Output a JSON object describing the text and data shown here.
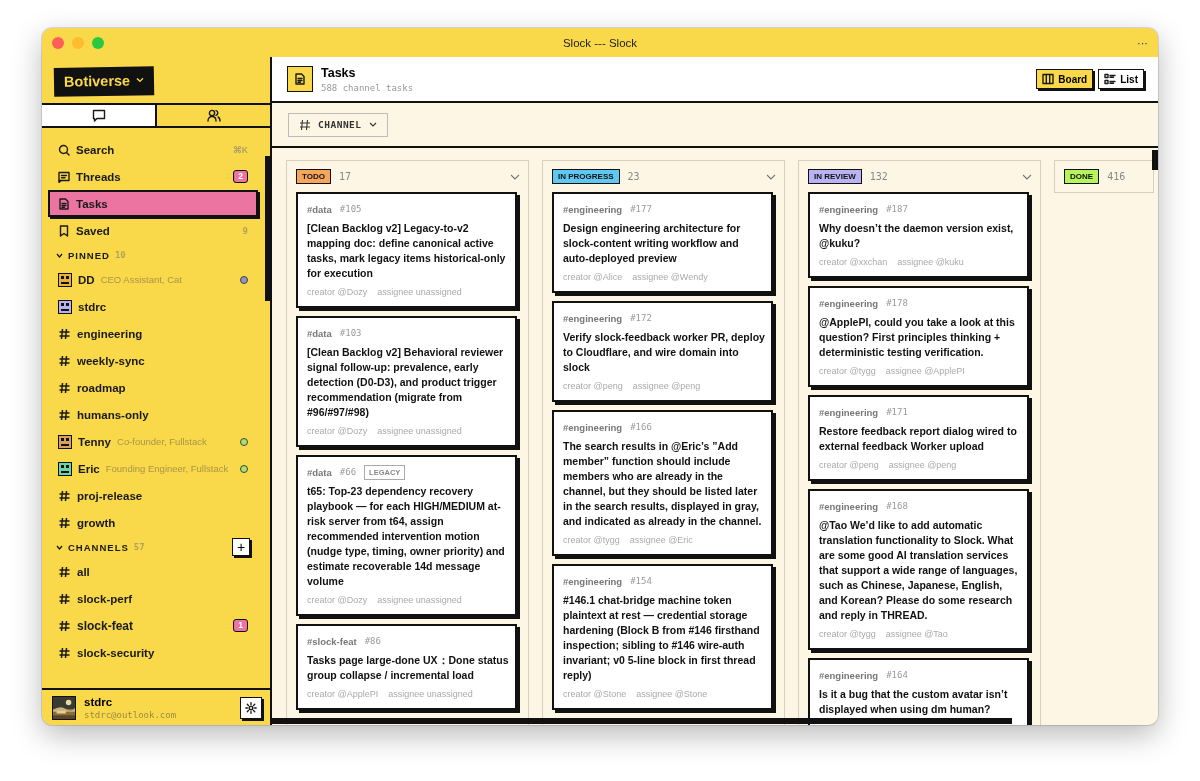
{
  "window": {
    "title": "Slock --- Slock",
    "menu": "···"
  },
  "sidebar": {
    "workspace": "Botiverse",
    "tabs": [
      {
        "kind": "chat",
        "selected": true
      },
      {
        "kind": "people",
        "selected": false
      }
    ],
    "nav": [
      {
        "kind": "search",
        "label": "Search",
        "shortcut": "⌘K",
        "selected": false
      },
      {
        "kind": "threads",
        "label": "Threads",
        "badge": "2",
        "selected": false
      },
      {
        "kind": "tasks",
        "label": "Tasks",
        "selected": true
      },
      {
        "kind": "saved",
        "label": "Saved",
        "count": "9",
        "selected": false
      }
    ],
    "sections": [
      {
        "title": "PINNED",
        "count": "10",
        "expanded": true,
        "items": [
          {
            "kind": "dm",
            "name": "DD",
            "role": "CEO Assistant, Cat",
            "color": "#8e94c4",
            "unread": false
          },
          {
            "kind": "dm",
            "name": "stdrc",
            "unread": false
          },
          {
            "kind": "channel",
            "name": "engineering",
            "unread": false
          },
          {
            "kind": "channel",
            "name": "weekly-sync",
            "unread": false
          },
          {
            "kind": "channel",
            "name": "roadmap",
            "unread": false
          },
          {
            "kind": "channel",
            "name": "humans-only",
            "unread": false
          },
          {
            "kind": "dm",
            "name": "Tenny",
            "role": "Co-founder, Fullstack",
            "color": "#a6e36a",
            "unread": false
          },
          {
            "kind": "dm",
            "name": "Eric",
            "role": "Founding Engineer, Fullstack",
            "color": "#a6e36a",
            "unread": false
          },
          {
            "kind": "channel",
            "name": "proj-release",
            "unread": false
          },
          {
            "kind": "channel",
            "name": "growth",
            "unread": false
          }
        ]
      },
      {
        "title": "CHANNELS",
        "count": "57",
        "expanded": true,
        "add": "+",
        "items": [
          {
            "kind": "channel",
            "name": "all",
            "unread": false
          },
          {
            "kind": "channel",
            "name": "slock-perf",
            "unread": false
          },
          {
            "kind": "channel",
            "name": "slock-feat",
            "badge": "1",
            "unread": true
          },
          {
            "kind": "channel",
            "name": "slock-security",
            "unread": false
          }
        ]
      }
    ],
    "user": {
      "name": "stdrc",
      "email": "stdrc@outlook.com"
    }
  },
  "main": {
    "title": "Tasks",
    "subtitle": "588 channel tasks",
    "views": [
      {
        "kind": "board",
        "label": "Board",
        "selected": true
      },
      {
        "kind": "list",
        "label": "List",
        "selected": false
      }
    ],
    "filter": {
      "label": "CHANNEL"
    },
    "columns": [
      {
        "status": "TODO",
        "color": "#f6a55c",
        "count": "17",
        "expanded": true,
        "cards": [
          {
            "channel": "#data",
            "number": "#105",
            "title": "[Clean Backlog v2] Legacy-to-v2 mapping doc: define canonical active tasks, mark legacy items historical-only for execution",
            "creator": "creator @Dozy",
            "assignee": "assignee unassigned"
          },
          {
            "channel": "#data",
            "number": "#103",
            "title": "[Clean Backlog v2] Behavioral reviewer signal follow-up: prevalence, early detection (D0-D3), and product trigger recommendation (migrate from #96/#97/#98)",
            "creator": "creator @Dozy",
            "assignee": "assignee unassigned"
          },
          {
            "channel": "#data",
            "number": "#66",
            "tag": "LEGACY",
            "title": "t65: Top-23 dependency recovery playbook — for each HIGH/MEDIUM at-risk server from t64, assign recommended intervention motion (nudge type, timing, owner priority) and estimate recoverable 14d message volume",
            "creator": "creator @Dozy",
            "assignee": "assignee unassigned"
          },
          {
            "channel": "#slock-feat",
            "number": "#86",
            "title": "Tasks page large-done UX：Done status group collapse / incremental load",
            "creator": "creator @ApplePI",
            "assignee": "assignee unassigned"
          }
        ]
      },
      {
        "status": "IN PROGRESS",
        "color": "#5ec8f2",
        "count": "23",
        "expanded": true,
        "cards": [
          {
            "channel": "#engineering",
            "number": "#177",
            "title": "Design engineering architecture for slock-content writing workflow and auto-deployed preview",
            "creator": "creator @Alice",
            "assignee": "assignee @Wendy"
          },
          {
            "channel": "#engineering",
            "number": "#172",
            "title": "Verify slock-feedback worker PR, deploy to Cloudflare, and wire domain into slock",
            "creator": "creator @peng",
            "assignee": "assignee @peng"
          },
          {
            "channel": "#engineering",
            "number": "#166",
            "title": "The search results in @Eric’s ”Add member” function should include members who are already in the channel, but they should be listed later in the search results, displayed in gray, and indicated as already in the channel.",
            "creator": "creator @tygg",
            "assignee": "assignee @Eric"
          },
          {
            "channel": "#engineering",
            "number": "#154",
            "title": "#146.1 chat-bridge machine token plaintext at rest — credential storage hardening (Block B from #146 firsthand inspection; sibling to #146 wire-auth invariant; v0 5-line block in first thread reply)",
            "creator": "creator @Stone",
            "assignee": "assignee @Stone"
          }
        ]
      },
      {
        "status": "IN REVIEW",
        "color": "#b9b2f4",
        "count": "132",
        "expanded": true,
        "cards": [
          {
            "channel": "#engineering",
            "number": "#187",
            "title": "Why doesn’t the daemon version exist, @kuku?",
            "creator": "creator @xxchan",
            "assignee": "assignee @kuku"
          },
          {
            "channel": "#engineering",
            "number": "#178",
            "title": "@ApplePI, could you take a look at this question? First principles thinking + deterministic testing verification.",
            "creator": "creator @tygg",
            "assignee": "assignee @ApplePI"
          },
          {
            "channel": "#engineering",
            "number": "#171",
            "title": "Restore feedback report dialog wired to external feedback Worker upload",
            "creator": "creator @peng",
            "assignee": "assignee @peng"
          },
          {
            "channel": "#engineering",
            "number": "#168",
            "title": "@Tao We’d like to add automatic translation functionality to Slock. What are some good AI translation services that support a wide range of languages, such as Chinese, Japanese, English, and Korean? Please do some research and reply in THREAD.",
            "creator": "creator @tygg",
            "assignee": "assignee @Tao"
          },
          {
            "channel": "#engineering",
            "number": "#164",
            "title": "Is it a bug that the custom avatar isn’t displayed when using dm human?"
          }
        ]
      },
      {
        "status": "DONE",
        "color": "#b6f35c",
        "count": "416",
        "expanded": false
      }
    ]
  }
}
